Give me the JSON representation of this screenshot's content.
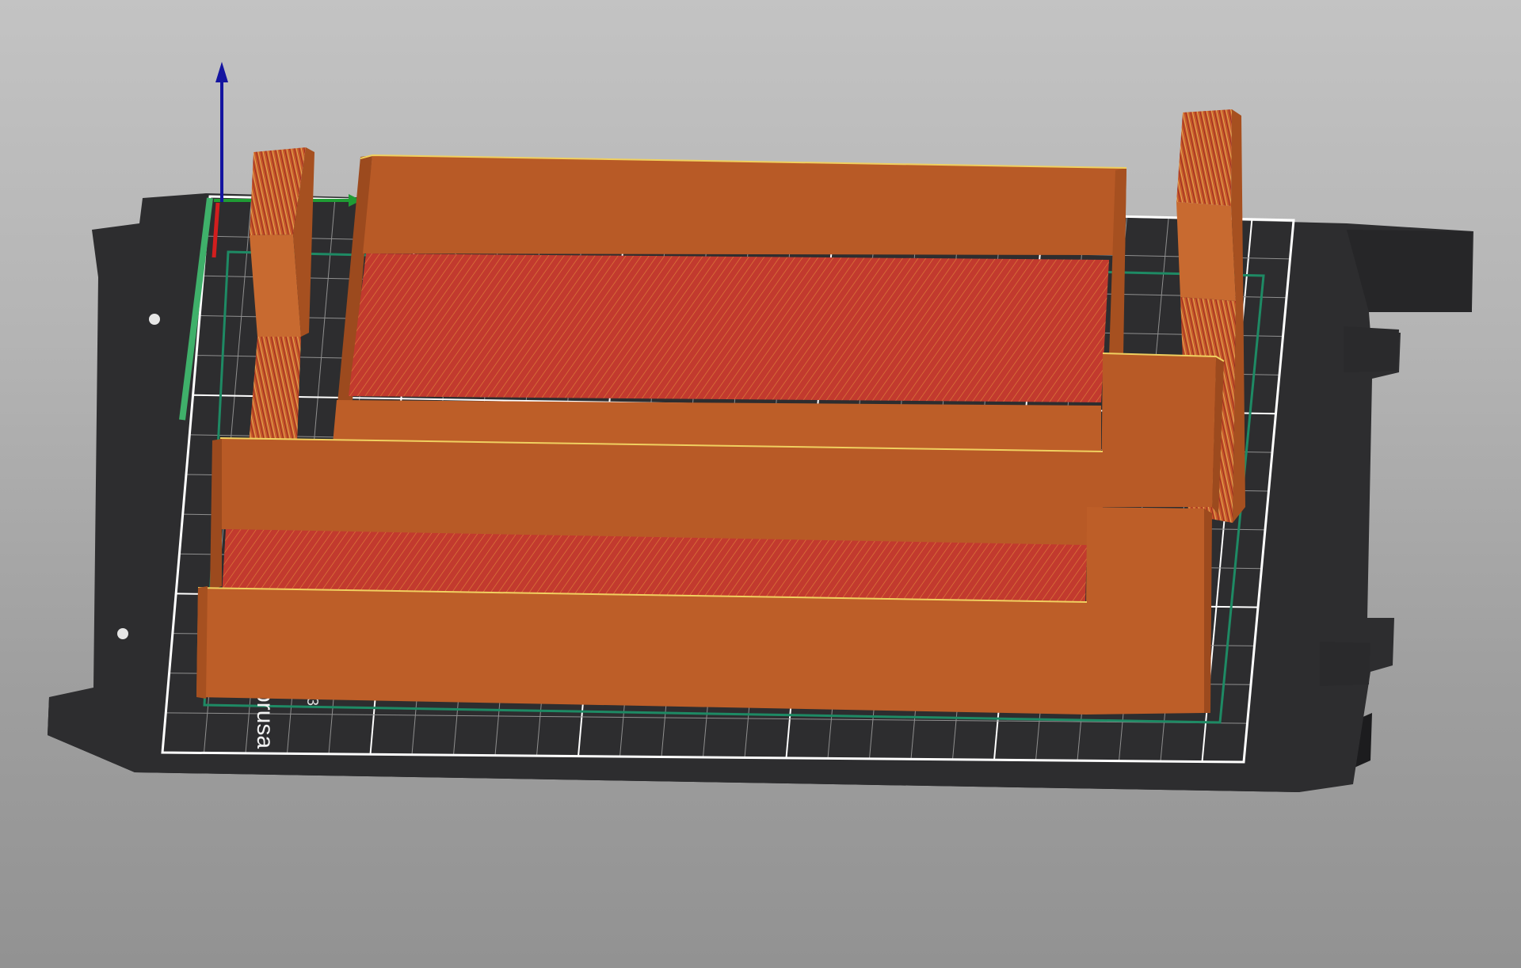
{
  "viewport": {
    "background_top": "#c3c3c3",
    "background_bottom": "#929292"
  },
  "bed": {
    "label": "prusa",
    "mark": "3",
    "plate_color": "#2d2d2f",
    "plate_edge_color": "#1c1c1e",
    "grid_color": "#8f8f8f",
    "grid_major_color": "#ffffff",
    "bed_outline_color": "#1e8a64"
  },
  "axes": {
    "x_color": "#1f9c34",
    "y_color": "#3fb06a",
    "z_color": "#1414a0",
    "origin_color": "#d21e1e"
  },
  "model": {
    "wall_color": "#b85a26",
    "wall_dark_color": "#9c4a1e",
    "wall_light_color": "#c86a30",
    "infill_color": "#c23a2e",
    "perimeter_highlight": "#f0d060"
  }
}
